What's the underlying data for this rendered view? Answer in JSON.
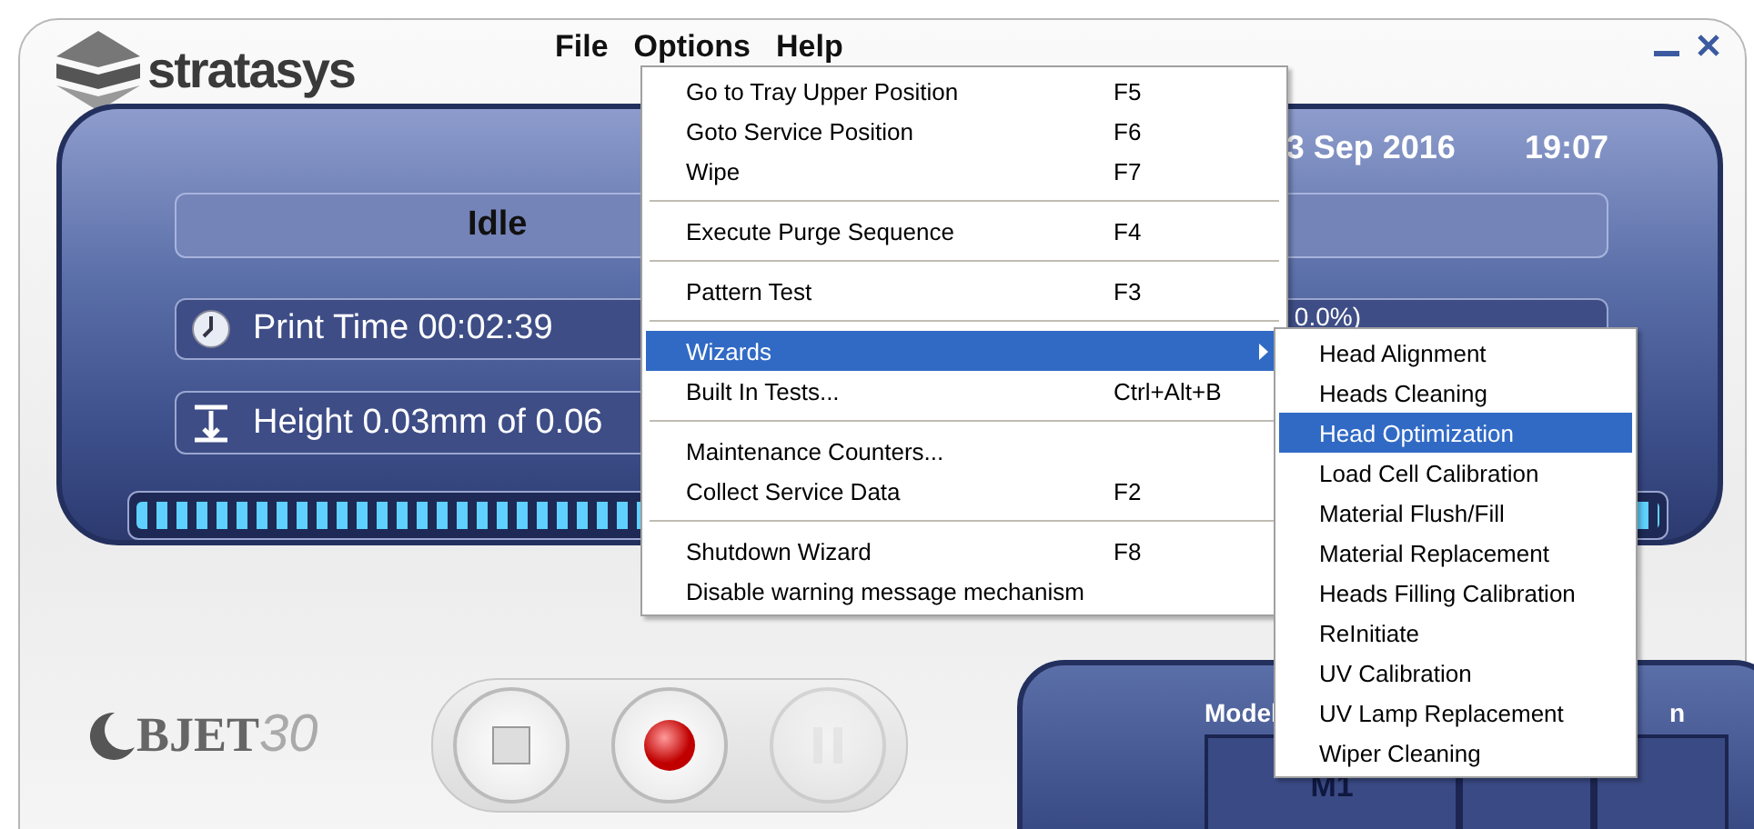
{
  "logo": {
    "brand": "stratasys"
  },
  "menubar": [
    {
      "label": "File"
    },
    {
      "label": "Options"
    },
    {
      "label": "Help"
    }
  ],
  "status": {
    "date": "3 Sep 2016",
    "time": "19:07",
    "state": "Idle",
    "print_time": "Print Time 00:02:39",
    "progress_text": "0.0%)",
    "height": "Height 0.03mm of 0.06"
  },
  "progress": {
    "level": 1
  },
  "product": {
    "name": "BJET",
    "number": "30"
  },
  "controls": [
    {
      "kind": "stop"
    },
    {
      "kind": "go"
    },
    {
      "kind": "pause",
      "disabled": true
    }
  ],
  "cartridges": {
    "heading": "Model",
    "heading_2": "n",
    "slots": [
      "M1"
    ]
  },
  "options_menu": [
    {
      "kind": "item",
      "label": "Go to Tray Upper Position",
      "shortcut": "F5",
      "selected": false
    },
    {
      "kind": "item",
      "label": "Goto Service Position",
      "shortcut": "F6",
      "selected": false
    },
    {
      "kind": "item",
      "label": "Wipe",
      "shortcut": "F7",
      "selected": false
    },
    {
      "kind": "separator"
    },
    {
      "kind": "item",
      "label": "Execute Purge Sequence",
      "shortcut": "F4",
      "selected": false
    },
    {
      "kind": "separator"
    },
    {
      "kind": "item",
      "label": "Pattern Test",
      "shortcut": "F3",
      "selected": false
    },
    {
      "kind": "separator"
    },
    {
      "kind": "submenu",
      "label": "Wizards",
      "selected": true
    },
    {
      "kind": "item",
      "label": "Built In Tests...",
      "shortcut": "Ctrl+Alt+B",
      "selected": false
    },
    {
      "kind": "separator"
    },
    {
      "kind": "item",
      "label": "Maintenance Counters...",
      "selected": false
    },
    {
      "kind": "item",
      "label": "Collect Service Data",
      "shortcut": "F2",
      "selected": false
    },
    {
      "kind": "separator"
    },
    {
      "kind": "item",
      "label": "Shutdown Wizard",
      "shortcut": "F8",
      "selected": false
    },
    {
      "kind": "item",
      "label": "Disable warning message mechanism",
      "selected": false
    }
  ],
  "wizards_menu": [
    {
      "label": "Head Alignment",
      "selected": false
    },
    {
      "label": "Heads Cleaning",
      "selected": false
    },
    {
      "label": "Head Optimization",
      "selected": true
    },
    {
      "label": "Load Cell Calibration",
      "selected": false
    },
    {
      "label": "Material Flush/Fill",
      "selected": false
    },
    {
      "label": "Material Replacement",
      "selected": false
    },
    {
      "label": "Heads Filling Calibration",
      "selected": false
    },
    {
      "label": "ReInitiate",
      "selected": false
    },
    {
      "label": "UV Calibration",
      "selected": false
    },
    {
      "label": "UV Lamp Replacement",
      "selected": false
    },
    {
      "label": "Wiper Cleaning",
      "selected": false
    }
  ]
}
